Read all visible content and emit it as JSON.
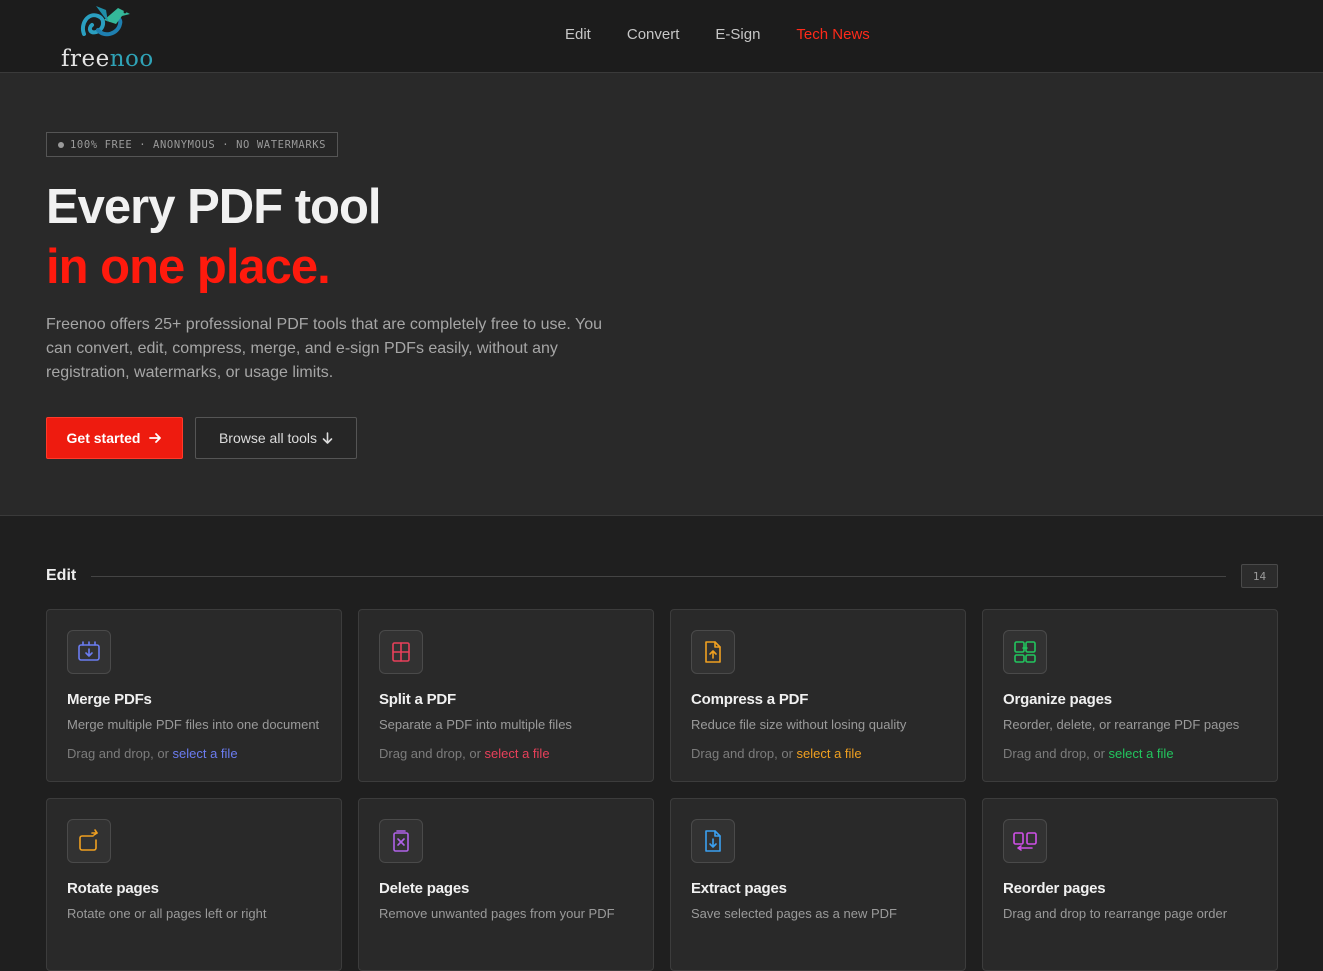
{
  "brand": {
    "name_part1": "free",
    "name_part2": "noo"
  },
  "nav": [
    {
      "label": "Edit",
      "active": false
    },
    {
      "label": "Convert",
      "active": false
    },
    {
      "label": "E-Sign",
      "active": false
    },
    {
      "label": "Tech News",
      "active": true
    }
  ],
  "hero": {
    "badge": "100% FREE · ANONYMOUS · NO WATERMARKS",
    "title_line1": "Every PDF tool",
    "title_line2": "in one place.",
    "lead": "Freenoo offers 25+ professional PDF tools that are completely free to use. You can convert, edit, compress, merge, and e-sign PDFs easily, without any registration, watermarks, or usage limits.",
    "primary_button": "Get started",
    "secondary_button": "Browse all tools"
  },
  "section": {
    "title": "Edit",
    "count": "14"
  },
  "drop_prefix": "Drag and drop, or ",
  "drop_link": "select a file",
  "tools": [
    {
      "title": "Merge PDFs",
      "desc": "Merge multiple PDF files into one document",
      "icon": "merge-icon",
      "color": "#6b7cf0",
      "show_drop": true
    },
    {
      "title": "Split a PDF",
      "desc": "Separate a PDF into multiple files",
      "icon": "split-icon",
      "color": "#e8405a",
      "show_drop": true
    },
    {
      "title": "Compress a PDF",
      "desc": "Reduce file size without losing quality",
      "icon": "compress-icon",
      "color": "#f0a020",
      "show_drop": true
    },
    {
      "title": "Organize pages",
      "desc": "Reorder, delete, or rearrange PDF pages",
      "icon": "organize-icon",
      "color": "#22c55e",
      "show_drop": true
    },
    {
      "title": "Rotate pages",
      "desc": "Rotate one or all pages left or right",
      "icon": "rotate-icon",
      "color": "#f0a020",
      "show_drop": false
    },
    {
      "title": "Delete pages",
      "desc": "Remove unwanted pages from your PDF",
      "icon": "delete-pages-icon",
      "color": "#b062e8",
      "show_drop": false
    },
    {
      "title": "Extract pages",
      "desc": "Save selected pages as a new PDF",
      "icon": "extract-icon",
      "color": "#3ba0f0",
      "show_drop": false
    },
    {
      "title": "Reorder pages",
      "desc": "Drag and drop to rearrange page order",
      "icon": "reorder-icon",
      "color": "#d050e8",
      "show_drop": false
    }
  ]
}
